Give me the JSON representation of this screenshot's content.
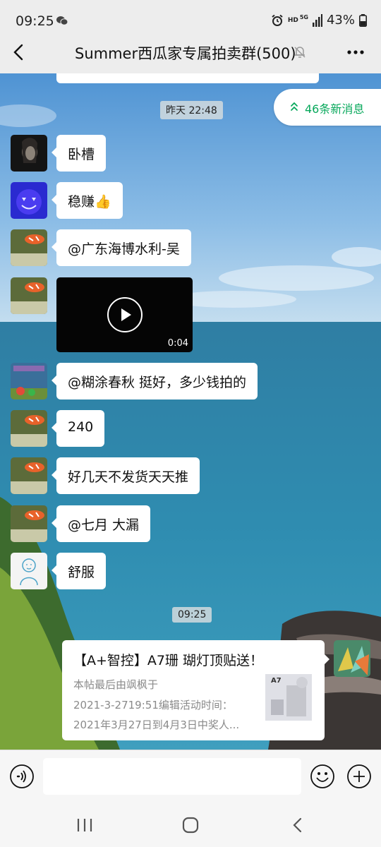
{
  "status_bar": {
    "time": "09:25",
    "network_badge_hd": "HD",
    "network_badge_5g": "5G",
    "battery": "43%"
  },
  "header": {
    "title": "Summer西瓜家专属拍卖群(500)"
  },
  "chat": {
    "new_messages": "46条新消息",
    "timestamp_1": "昨天 22:48",
    "timestamp_2": "09:25",
    "messages": [
      {
        "text": "卧槽"
      },
      {
        "text": "稳赚👍"
      },
      {
        "text": "@广东海博水利-吴"
      },
      {
        "video_duration": "0:04"
      },
      {
        "text": "@糊涂春秋  挺好，多少钱拍的"
      },
      {
        "text": "240"
      },
      {
        "text": "好几天不发货天天推"
      },
      {
        "text": "@七月  大漏"
      },
      {
        "text": "舒服"
      }
    ],
    "card": {
      "title": "【A+智控】A7珊 瑚灯顶贴送！",
      "line1": "本帖最后由飒枫于",
      "line2": "2021-3-2719:51编辑活动时间：",
      "line3": "2021年3月27日到4月3日中奖人...",
      "thumb_text": "A7"
    }
  }
}
